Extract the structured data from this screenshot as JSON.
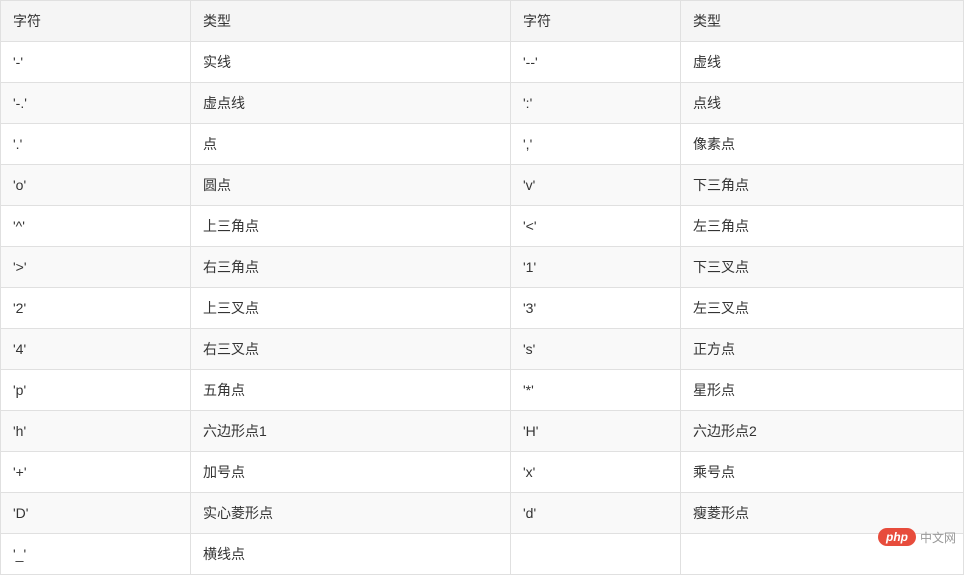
{
  "table": {
    "headers": [
      "字符",
      "类型",
      "字符",
      "类型"
    ],
    "rows": [
      {
        "char1": "'-'",
        "type1": "实线",
        "char2": "'--'",
        "type2": "虚线"
      },
      {
        "char1": "'-.'",
        "type1": "虚点线",
        "char2": "':'",
        "type2": "点线"
      },
      {
        "char1": "'.'",
        "type1": "点",
        "char2": "','",
        "type2": "像素点"
      },
      {
        "char1": "'o'",
        "type1": "圆点",
        "char2": "'v'",
        "type2": "下三角点"
      },
      {
        "char1": "'^'",
        "type1": "上三角点",
        "char2": "'<'",
        "type2": "左三角点"
      },
      {
        "char1": "'>'",
        "type1": "右三角点",
        "char2": "'1'",
        "type2": "下三叉点"
      },
      {
        "char1": "'2'",
        "type1": "上三叉点",
        "char2": "'3'",
        "type2": "左三叉点"
      },
      {
        "char1": "'4'",
        "type1": "右三叉点",
        "char2": "'s'",
        "type2": "正方点"
      },
      {
        "char1": "'p'",
        "type1": "五角点",
        "char2": "'*'",
        "type2": "星形点"
      },
      {
        "char1": "'h'",
        "type1": "六边形点1",
        "char2": "'H'",
        "type2": "六边形点2"
      },
      {
        "char1": "'+'",
        "type1": "加号点",
        "char2": "'x'",
        "type2": "乘号点"
      },
      {
        "char1": "'D'",
        "type1": "实心菱形点",
        "char2": "'d'",
        "type2": "瘦菱形点"
      },
      {
        "char1": "'_'",
        "type1": "横线点",
        "char2": "",
        "type2": ""
      }
    ]
  },
  "watermark": {
    "badge": "php",
    "text": "中文网"
  }
}
